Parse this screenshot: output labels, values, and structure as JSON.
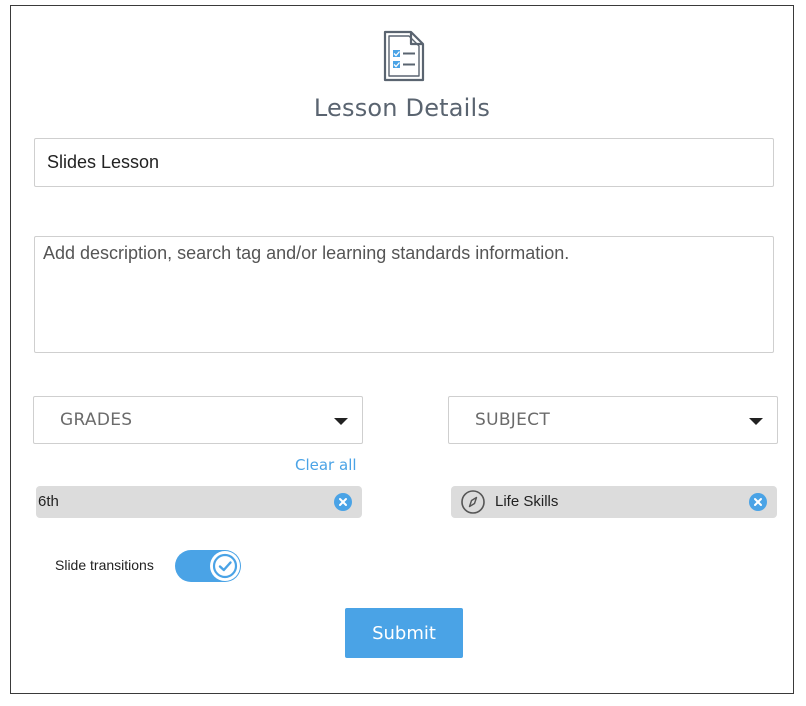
{
  "header": {
    "icon": "checklist-document-icon",
    "title": "Lesson Details"
  },
  "lesson_name": {
    "value": "Slides Lesson"
  },
  "description": {
    "value": "",
    "placeholder": "Add description, search tag and/or learning standards information."
  },
  "grades": {
    "label": "GRADES",
    "clear_all": "Clear all",
    "selected": [
      {
        "label": "6th",
        "icon": "close-circle-icon"
      }
    ]
  },
  "subject": {
    "label": "SUBJECT",
    "selected": [
      {
        "label": "Life Skills",
        "icon": "compass-icon",
        "remove_icon": "close-circle-icon"
      }
    ]
  },
  "slide_transitions": {
    "label": "Slide transitions",
    "enabled": true
  },
  "submit": {
    "label": "Submit"
  },
  "colors": {
    "accent": "#4aa3e6",
    "title": "#5a6470",
    "chip_bg": "#dcdcdc",
    "border": "#cfcfcf"
  }
}
